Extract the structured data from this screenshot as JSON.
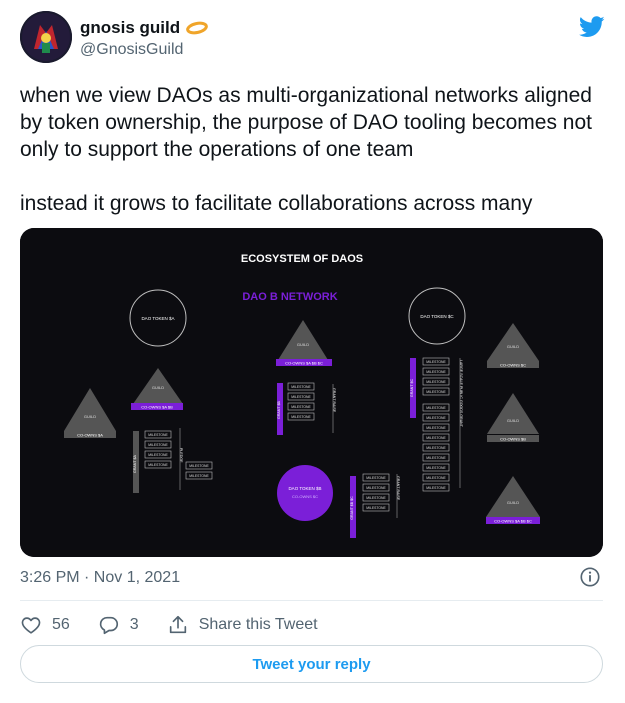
{
  "user": {
    "display_name": "gnosis guild",
    "handle": "@GnosisGuild",
    "avatar_icon": "guild-avatar",
    "badge_icon": "orange-halo-icon"
  },
  "tweet": {
    "text": "when we view DAOs as multi-organizational networks aligned by token ownership, the purpose of DAO tooling becomes not only to support the operations of one team\n\ninstead it grows to facilitate collaborations across many",
    "timestamp": "3:26 PM · Nov 1, 2021"
  },
  "media": {
    "title": "ECOSYSTEM OF DAOS",
    "network_label": "DAO B NETWORK",
    "token_a": "DAO TOKEN $A",
    "token_c": "DAO TOKEN $C",
    "token_b": "DAO TOKEN $B",
    "token_b_sub": "CO-OWNS $C",
    "guild": "GUILD",
    "coowns_ab": "CO-OWNS $A $B",
    "coowns_abc": "CO-OWNS $A $B $C",
    "coowns_a": "CO-OWNS $A",
    "coowns_c": "CO-OWNS $C",
    "coowns_b": "CO-OWNS $B",
    "milestone": "MILESTONE",
    "grant_a": "GRANT $A",
    "grant_b": "GRANT $B",
    "grant_c": "GRANT $C",
    "grant_bc": "GRANT $B $C",
    "pledge_lbl": "PLEDGE",
    "grant_raise": "GRANT RAISE",
    "public_lbl": "LARGE SCALE PUBLIC GOODS GRANT"
  },
  "stats": {
    "likes": "56",
    "replies": "3",
    "share_label": "Share this Tweet"
  },
  "reply_button": "Tweet your reply",
  "colors": {
    "accent": "#1d9bf0",
    "purple": "#7b1fd8",
    "media_bg": "#0c0c10"
  }
}
